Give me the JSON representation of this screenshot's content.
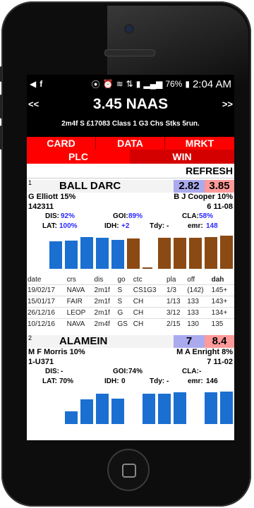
{
  "status_bar": {
    "battery": "76%",
    "time": "2:04 AM"
  },
  "nav": {
    "prev": "<<",
    "next": ">>"
  },
  "race": {
    "title": "3.45 NAAS",
    "subtitle": "2m4f S £17083 Class 1 G3 Chs Stks 5run."
  },
  "tabs_row1": [
    "CARD",
    "DATA",
    "MRKT"
  ],
  "tabs_row2": [
    "PLC",
    "WIN"
  ],
  "refresh_label": "REFRESH",
  "colors": {
    "tab_red": "#ff0000",
    "tab_dark_red": "#d40000",
    "bar_blue": "#1b6fd1",
    "bar_brown": "#8b4a14",
    "odds_blue": "#aaaaee",
    "odds_red": "#ff9a9a"
  },
  "runners": [
    {
      "number": "1",
      "name": "BALL DARC",
      "odds_a": "2.82",
      "odds_b": "3.85",
      "trainer": "G Elliott 15%",
      "jockey": "B J Cooper 10%",
      "form": "142311",
      "age_weight": "6 11-08",
      "dis_label": "DIS:",
      "dis": "92%",
      "goi_label": "GOI:",
      "goi": "89%",
      "cla_label": "CLA:",
      "cla": "58%",
      "lat_label": "LAT:",
      "lat": "100%",
      "idh_label": "IDH:",
      "idh": "+2",
      "tdy_label": "Tdy:",
      "tdy": "-",
      "emr_label": "emr:",
      "emr": "148",
      "bars": [
        {
          "level": 0.78,
          "color": "blue"
        },
        {
          "level": 0.8,
          "color": "blue"
        },
        {
          "level": 0.9,
          "color": "blue"
        },
        {
          "level": 0.88,
          "color": "blue"
        },
        {
          "level": 0.82,
          "color": "blue"
        },
        {
          "level": 0.86,
          "color": "brown"
        },
        {
          "level": 0.04,
          "color": "brown"
        },
        {
          "level": 0.88,
          "color": "brown"
        },
        {
          "level": 0.88,
          "color": "brown"
        },
        {
          "level": 0.88,
          "color": "brown"
        },
        {
          "level": 0.9,
          "color": "brown"
        },
        {
          "level": 0.94,
          "color": "brown"
        },
        {
          "level": 0.94,
          "color": "brown"
        }
      ],
      "table_headers": [
        "date",
        "crs",
        "dis",
        "go",
        "ctc",
        "pla",
        "off",
        "dah"
      ],
      "table_rows": [
        [
          "19/02/17",
          "NAVA",
          "2m1f",
          "S",
          "CS1G3",
          "1/3",
          "(142)",
          "145+"
        ],
        [
          "15/01/17",
          "FAIR",
          "2m1f",
          "S",
          "CH",
          "1/13",
          "133",
          "143+"
        ],
        [
          "26/12/16",
          "LEOP",
          "2m1f",
          "G",
          "CH",
          "3/12",
          "133",
          "134+"
        ],
        [
          "10/12/16",
          "NAVA",
          "2m4f",
          "GS",
          "CH",
          "2/15",
          "130",
          "135"
        ]
      ]
    },
    {
      "number": "2",
      "name": "ALAMEIN",
      "odds_a": "7",
      "odds_b": "8.4",
      "trainer": "M F Morris 10%",
      "jockey": "M A Enright 8%",
      "form": "1-U371",
      "age_weight": "7 11-02",
      "dis_label": "DIS:",
      "dis": "-",
      "goi_label": "GOI:",
      "goi": "74%",
      "cla_label": "CLA:",
      "cla": "-",
      "lat_label": "LAT:",
      "lat": "70%",
      "idh_label": "IDH:",
      "idh": "0",
      "tdy_label": "Tdy:",
      "tdy": "-",
      "emr_label": "emr:",
      "emr": "146",
      "bars": [
        {
          "level": 0.0,
          "color": "blue"
        },
        {
          "level": 0.36,
          "color": "blue"
        },
        {
          "level": 0.7,
          "color": "blue"
        },
        {
          "level": 0.86,
          "color": "blue"
        },
        {
          "level": 0.72,
          "color": "blue"
        },
        {
          "level": 0.0,
          "color": "blue"
        },
        {
          "level": 0.86,
          "color": "blue"
        },
        {
          "level": 0.86,
          "color": "blue"
        },
        {
          "level": 0.9,
          "color": "blue"
        },
        {
          "level": 0.0,
          "color": "blue"
        },
        {
          "level": 0.9,
          "color": "blue"
        },
        {
          "level": 0.92,
          "color": "blue"
        },
        {
          "level": 1.0,
          "color": "brown"
        }
      ]
    }
  ]
}
